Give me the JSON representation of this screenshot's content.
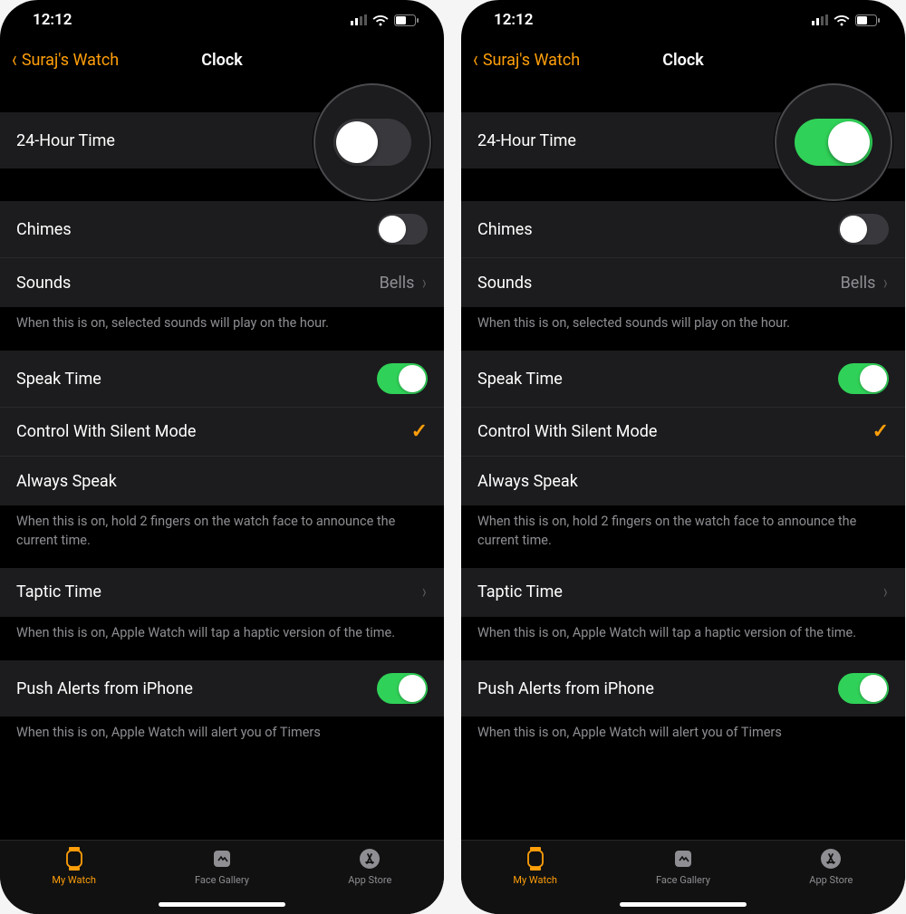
{
  "status": {
    "time": "12:12"
  },
  "nav": {
    "back_label": "Suraj's Watch",
    "title": "Clock"
  },
  "colors": {
    "accent": "#ff9f0a",
    "toggle_on": "#30d158"
  },
  "rows": {
    "tf_hour": {
      "label": "24-Hour Time"
    },
    "chimes": {
      "label": "Chimes"
    },
    "sounds": {
      "label": "Sounds",
      "value": "Bells"
    },
    "chimes_footer": "When this is on, selected sounds will play on the hour.",
    "speak_time": {
      "label": "Speak Time"
    },
    "control_silent": {
      "label": "Control With Silent Mode"
    },
    "always_speak": {
      "label": "Always Speak"
    },
    "speak_footer": "When this is on, hold 2 fingers on the watch face to announce the current time.",
    "taptic_time": {
      "label": "Taptic Time"
    },
    "taptic_footer": "When this is on, Apple Watch will tap a haptic version of the time.",
    "push_alerts": {
      "label": "Push Alerts from iPhone"
    },
    "push_footer": "When this is on, Apple Watch will alert you of Timers"
  },
  "tabs": {
    "my_watch": "My Watch",
    "face_gallery": "Face Gallery",
    "app_store": "App Store"
  },
  "screens": [
    {
      "tf_hour_on": false
    },
    {
      "tf_hour_on": true
    }
  ]
}
